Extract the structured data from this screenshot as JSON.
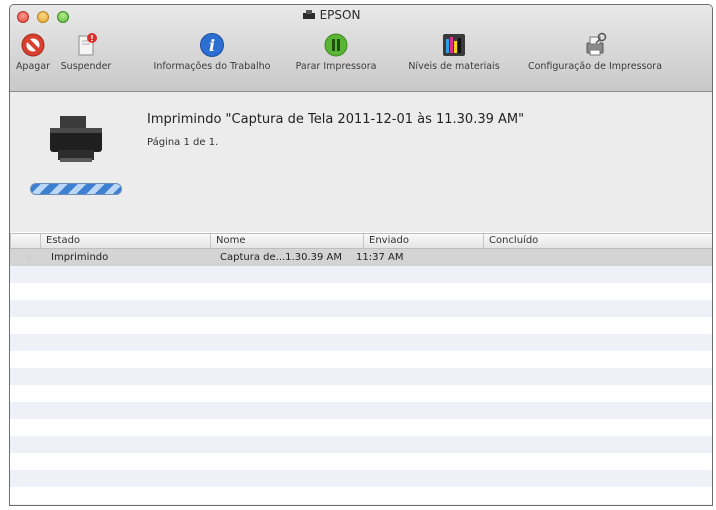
{
  "window": {
    "title": "EPSON"
  },
  "toolbar": {
    "buttons": [
      {
        "label": "Apagar",
        "icon": "delete-icon"
      },
      {
        "label": "Suspender",
        "icon": "suspend-icon"
      },
      {
        "label": "Informações do Trabalho",
        "icon": "info-icon"
      },
      {
        "label": "Parar Impressora",
        "icon": "pause-icon"
      },
      {
        "label": "Níveis de materiais",
        "icon": "supply-levels-icon"
      },
      {
        "label": "Configuração de Impressora",
        "icon": "printer-setup-icon"
      }
    ]
  },
  "job": {
    "title": "Imprimindo \"Captura de Tela 2011-12-01 às 11.30.39 AM\"",
    "page": "Página 1 de 1."
  },
  "table": {
    "columns": [
      "Estado",
      "Nome",
      "Enviado",
      "Concluído"
    ],
    "rows": [
      {
        "estado": "Imprimindo",
        "nome": "Captura de...1.30.39 AM",
        "enviado": "11:37 AM",
        "concluido": ""
      }
    ]
  },
  "colors": {
    "accent": "#3d7fd0",
    "delete": "#d9402f",
    "pause": "#5ab534",
    "info": "#2d6ed3"
  }
}
